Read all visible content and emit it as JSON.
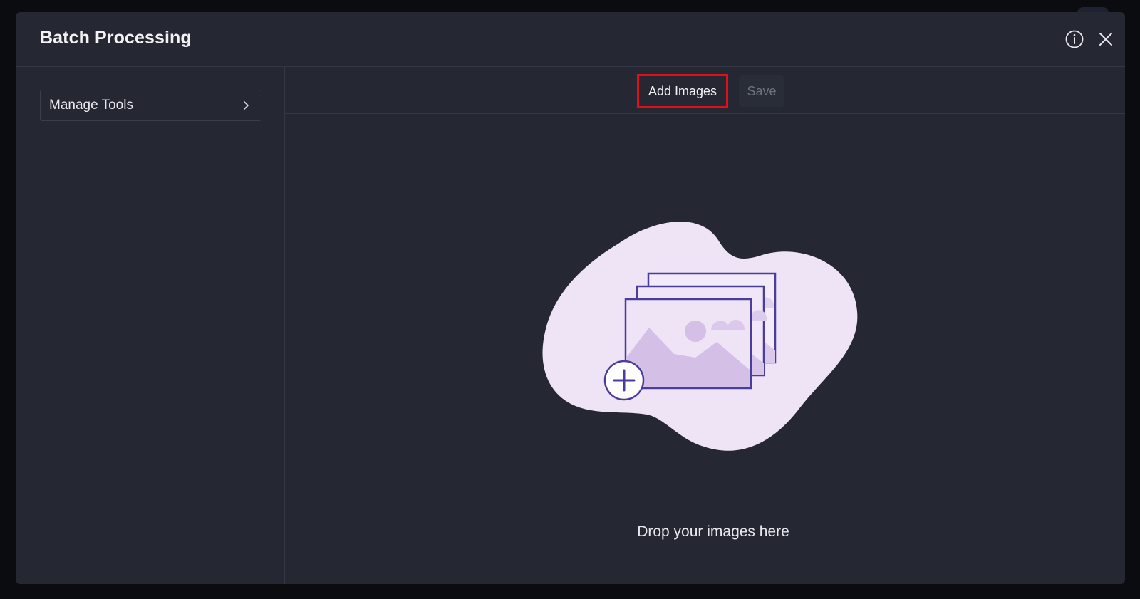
{
  "dialog": {
    "title": "Batch Processing",
    "info_icon": "info-icon",
    "close_icon": "close-icon"
  },
  "sidebar": {
    "manage_tools_label": "Manage Tools",
    "manage_tools_icon": "chevron-right-icon"
  },
  "toolbar": {
    "add_images_label": "Add Images",
    "save_label": "Save",
    "save_disabled": true
  },
  "drop_zone": {
    "illustration_icon": "add-images-illustration",
    "text": "Drop your images here"
  },
  "colors": {
    "background": "#0b0c10",
    "panel": "#252833",
    "highlight_border": "#e0101b",
    "illustration_blob": "#efe3f6",
    "illustration_stroke": "#4b3d9a",
    "illustration_fill": "#d6c2e9"
  }
}
